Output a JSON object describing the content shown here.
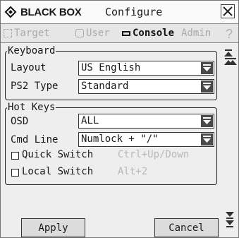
{
  "window": {
    "brand": "BLACK BOX",
    "title": "Configure",
    "close_icon": "close-icon"
  },
  "tabs": [
    {
      "label": "Target",
      "icon": "target-icon",
      "state": "disabled"
    },
    {
      "label": "User",
      "icon": "user-icon",
      "state": "disabled"
    },
    {
      "label": "Console",
      "icon": "console-icon",
      "state": "active"
    },
    {
      "label": "Admin",
      "icon": "",
      "state": "disabled"
    }
  ],
  "help_label": "?",
  "keyboard": {
    "group_label": "Keyboard",
    "layout_label": "Layout",
    "layout_value": "US English",
    "ps2_label": "PS2 Type",
    "ps2_value": "Standard"
  },
  "hotkeys": {
    "group_label": "Hot Keys",
    "osd_label": "OSD",
    "osd_value": "ALL",
    "cmd_label": "Cmd Line",
    "cmd_value": "Numlock + \"/\"",
    "quick_switch_label": "Quick Switch",
    "quick_switch_hint": "Ctrl+Up/Down",
    "quick_switch_checked": false,
    "local_switch_label": "Local Switch",
    "local_switch_hint": "Alt+2",
    "local_switch_checked": false
  },
  "buttons": {
    "apply": "Apply",
    "cancel": "Cancel"
  },
  "colors": {
    "background": "#eeeeee",
    "disabled_text": "#aaaaaa",
    "dropdown_arrow": "#4a4a4a"
  }
}
